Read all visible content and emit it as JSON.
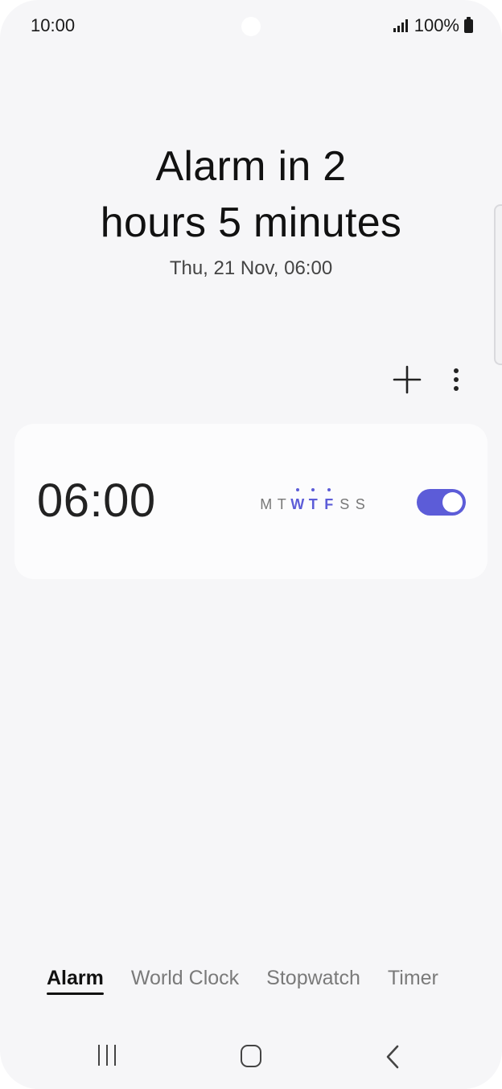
{
  "status_bar": {
    "time": "10:00",
    "battery": "100%",
    "icons": [
      "signal-icon",
      "battery-icon"
    ]
  },
  "header": {
    "headline_line1": "Alarm in 2",
    "headline_line2": "hours 5 minutes",
    "next_alarm_date": "Thu, 21 Nov, 06:00"
  },
  "toolbar": {
    "icons": [
      "add-icon",
      "more-options-icon"
    ]
  },
  "alarm": {
    "time": "06:00",
    "enabled": true,
    "days": [
      {
        "label": "M",
        "active": false
      },
      {
        "label": "T",
        "active": false
      },
      {
        "label": "W",
        "active": true
      },
      {
        "label": "T",
        "active": true
      },
      {
        "label": "F",
        "active": true
      },
      {
        "label": "S",
        "active": false
      },
      {
        "label": "S",
        "active": false
      }
    ]
  },
  "tabs": [
    {
      "label": "Alarm",
      "active": true
    },
    {
      "label": "World Clock",
      "active": false
    },
    {
      "label": "Stopwatch",
      "active": false
    },
    {
      "label": "Timer",
      "active": false
    }
  ],
  "nav_bar": {
    "icons": [
      "recent-apps-icon",
      "home-icon",
      "back-icon"
    ]
  },
  "colors": {
    "accent": "#5c5cd8",
    "background": "#f6f6f8",
    "card": "#fcfcfd"
  }
}
